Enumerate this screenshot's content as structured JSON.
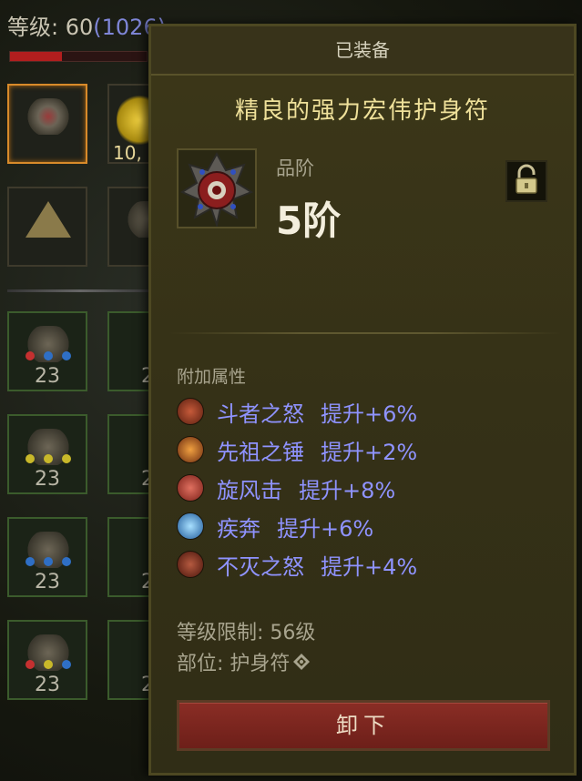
{
  "player": {
    "level_label": "等级: 60",
    "paragon": "(1026)",
    "xp_fraction": 0.38
  },
  "inventory": {
    "gold_count": "10,",
    "gem_counts": [
      "23",
      "23",
      "23",
      "23"
    ],
    "partial_counts": [
      "2",
      "2",
      "2",
      "2"
    ]
  },
  "tooltip": {
    "header": "已装备",
    "item_name": "精良的强力宏伟护身符",
    "rank_label": "品阶",
    "rank_value": "5阶",
    "attributes_title": "附加属性",
    "attributes": [
      {
        "name": "斗者之怒",
        "bonus": "提升+6%",
        "icon": "berserker-icon",
        "color": "#8a3b26"
      },
      {
        "name": "先祖之锤",
        "bonus": "提升+2%",
        "icon": "hammer-icon",
        "color": "#c0682a"
      },
      {
        "name": "旋风击",
        "bonus": "提升+8%",
        "icon": "whirlwind-icon",
        "color": "#b04236"
      },
      {
        "name": "疾奔",
        "bonus": "提升+6%",
        "icon": "sprint-icon",
        "color": "#3a7cc8"
      },
      {
        "name": "不灭之怒",
        "bonus": "提升+4%",
        "icon": "wrath-icon",
        "color": "#7d2c20"
      }
    ],
    "level_requirement": "等级限制: 56级",
    "slot_label": "部位: 护身符",
    "unequip_label": "卸下"
  },
  "colors": {
    "attribute_text": "#8f93ff",
    "item_name": "#efe19a",
    "button": "#8a2d25"
  }
}
